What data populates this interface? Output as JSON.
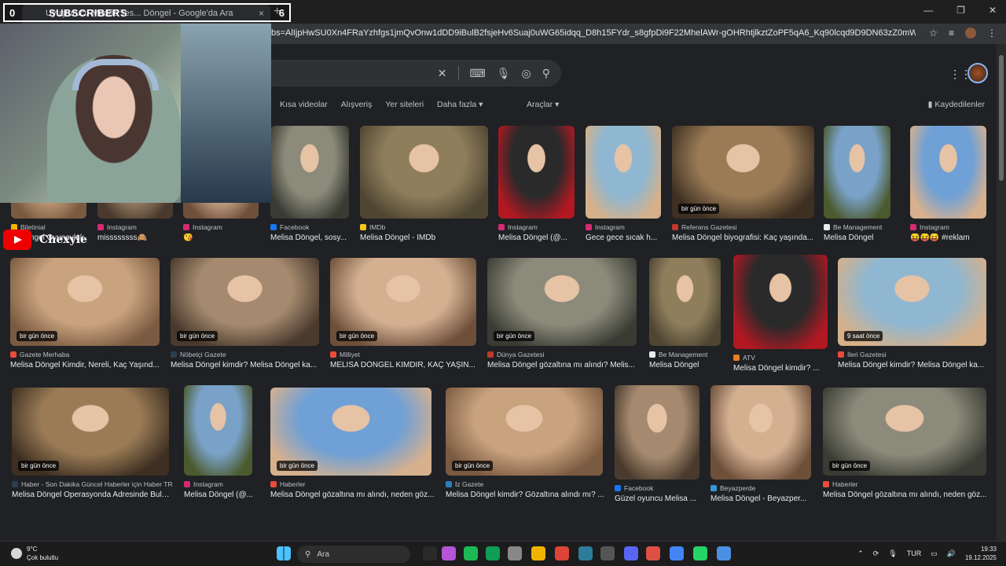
{
  "browser": {
    "tab_title": "Uyuşturucu Madde Tes... Döngel - Google'da Ara",
    "tab_close": "×",
    "new_tab": "+",
    "url": "bs=AlIjpHwSU0Xn4FRaYzhfgs1jmQvOnw1dDD9iBulB2fsjeHv6Suaj0uWG65idqq_D8h15FYdr_s8gfpDi9F22MhelAWr-gOHRhtjlkztZoPF5qA6_Kq90lcqd9D9DN63zZ0mWEl3e0eeaXFfBKZfAfl0tUKLO7li8kY...",
    "win_controls": [
      "—",
      "❐",
      "✕"
    ]
  },
  "google": {
    "filters": [
      "Kısa videolar",
      "Alışveriş",
      "Yer siteleri",
      "Daha fazla ▾"
    ],
    "tools": "Araçlar ▾",
    "saved": "Kaydedilenler"
  },
  "overlay": {
    "left_count": "0",
    "label": "SUBSCRIBERS",
    "right_count": "6",
    "channel": "Chexyie"
  },
  "results": [
    {
      "src": "Biletinial",
      "title": "... Döngel Oyunculuk",
      "fav": "#f4b400"
    },
    {
      "src": "Instagram",
      "title": "missssssss🙈",
      "fav": "#d62976"
    },
    {
      "src": "Instagram",
      "title": "😘",
      "fav": "#d62976"
    },
    {
      "src": "Facebook",
      "title": "Melisa Döngel, sosy...",
      "fav": "#1877f2"
    },
    {
      "src": "IMDb",
      "title": "Melisa Döngel - IMDb",
      "fav": "#f5c518"
    },
    {
      "src": "Instagram",
      "title": "Melisa Döngel (@...",
      "fav": "#d62976"
    },
    {
      "src": "Instagram",
      "title": "Gece gece sıcak h...",
      "fav": "#d62976"
    },
    {
      "src": "Referans Gazetesi",
      "title": "Melisa Döngel biyografisi: Kaç yaşında...",
      "fav": "#c0392b",
      "badge": "bir gün önce"
    },
    {
      "src": "Be Management",
      "title": "Melisa Döngel",
      "fav": "#e8eaed"
    },
    {
      "src": "Instagram",
      "title": "😝😝😝 #reklam",
      "fav": "#d62976"
    },
    {
      "src": "Gazete Merhaba",
      "title": "Melisa Döngel Kimdir, Nereli, Kaç Yaşınd...",
      "fav": "#e74c3c",
      "badge": "bir gün önce"
    },
    {
      "src": "Nöbetçi Gazete",
      "title": "Melisa Döngel kimdir? Melisa Döngel ka...",
      "fav": "#2c3e50",
      "badge": "bir gün önce"
    },
    {
      "src": "Milliyet",
      "title": "MELİSA DÖNGEL KİMDİR, KAÇ YAŞIN...",
      "fav": "#e74c3c",
      "badge": "bir gün önce"
    },
    {
      "src": "Dünya Gazetesi",
      "title": "Melisa Döngel gözaltına mı alındı? Melis...",
      "fav": "#c0392b",
      "badge": "bir gün önce"
    },
    {
      "src": "Be Management",
      "title": "Melisa Döngel",
      "fav": "#e8eaed"
    },
    {
      "src": "ATV",
      "title": "Melisa Döngel kimdir? ...",
      "fav": "#e67e22"
    },
    {
      "src": "İleri Gazetesi",
      "title": "Melisa Döngel kimdir? Melisa Döngel ka...",
      "fav": "#e74c3c",
      "badge": "9 saat önce"
    },
    {
      "src": "Haber - Son Dakika Güncel Haberler için Haber TR",
      "title": "Melisa Döngel Operasyonda Adresinde Bulu...",
      "fav": "#2c3e50",
      "badge": "bir gün önce"
    },
    {
      "src": "Instagram",
      "title": "Melisa Döngel (@...",
      "fav": "#d62976"
    },
    {
      "src": "Haberler",
      "title": "Melisa Döngel gözaltına mı alındı, neden göz...",
      "fav": "#e74c3c",
      "badge": "bir gün önce"
    },
    {
      "src": "İz Gazete",
      "title": "Melisa Döngel kimdir? Gözaltına alındı mı? ...",
      "fav": "#2980b9",
      "badge": "bir gün önce"
    },
    {
      "src": "Facebook",
      "title": "Güzel oyuncu Melisa ...",
      "fav": "#1877f2"
    },
    {
      "src": "Beyazperde",
      "title": "Melisa Döngel - Beyazper...",
      "fav": "#3498db"
    },
    {
      "src": "Haberler",
      "title": "Melisa Döngel gözaltına mı alındı, neden göz...",
      "fav": "#e74c3c",
      "badge": "bir gün önce"
    }
  ],
  "taskbar": {
    "temp": "9°C",
    "weather": "Çok bulutlu",
    "search": "Ara",
    "lang": "TUR",
    "time": "19:33",
    "date": "19.12.2025"
  }
}
